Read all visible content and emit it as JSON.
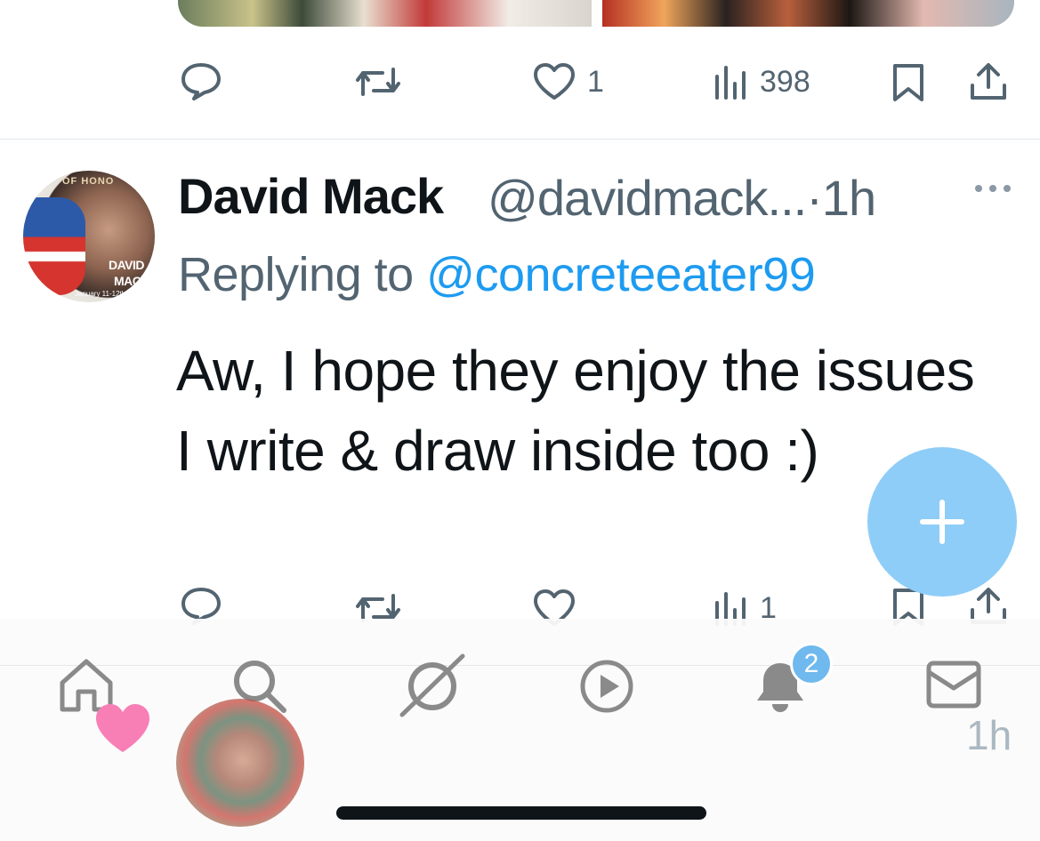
{
  "prev_tweet": {
    "actions": {
      "reply_icon": "speech-bubble-icon",
      "retweet_icon": "retweet-icon",
      "like_count": "1",
      "views_count": "398"
    }
  },
  "tweet": {
    "author_name": "David Mack",
    "author_handle": "@davidmack...",
    "separator": "·",
    "time": "1h",
    "replying_prefix": "Replying to ",
    "replying_to": "@concreteeater99",
    "text": "Aw, I hope they enjoy the issues I write & draw inside too :)",
    "avatar": {
      "banner_text": "OF HONO",
      "name_line1": "DAVID",
      "name_line2": "MACK",
      "date_text": "January 11-12th"
    },
    "actions": {
      "like_count": "",
      "views_count": "1"
    }
  },
  "tabbar": {
    "notifications_badge": "2",
    "faded_time": "1h"
  },
  "colors": {
    "accent": "#1d9bf0",
    "fab": "#8ecdf7",
    "muted": "#536471"
  }
}
